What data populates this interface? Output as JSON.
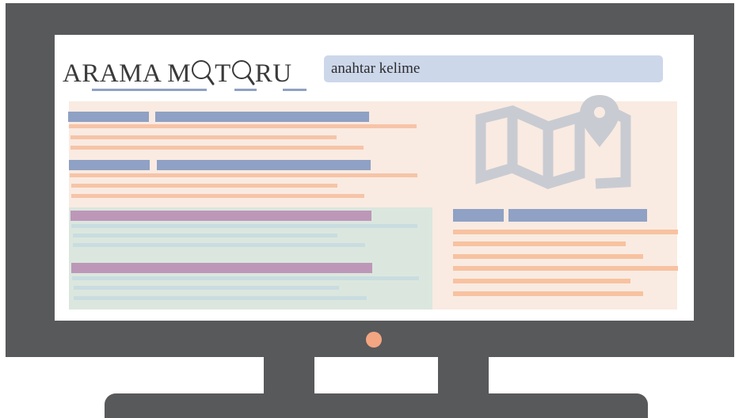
{
  "logo": {
    "text_before": "ARAMA M",
    "text_middle": "T",
    "text_after": "RU"
  },
  "search": {
    "value": "anahtar kelime"
  },
  "icons": {
    "logo_o1": "magnifier-icon",
    "logo_o2": "magnifier-icon",
    "map": "map-with-pin-icon"
  },
  "colors": {
    "bezel": "#58595b",
    "search_bg": "#ccd7ea",
    "title_bar": "#8fa1c4",
    "ad_title_bar": "#bd97b8",
    "text_line": "#f6c4a8",
    "panel_bg": "#f9ebe2",
    "ad_panel_bg": "#dbe7de",
    "power_led": "#f4a582",
    "map_icon": "#c9cbd2"
  }
}
